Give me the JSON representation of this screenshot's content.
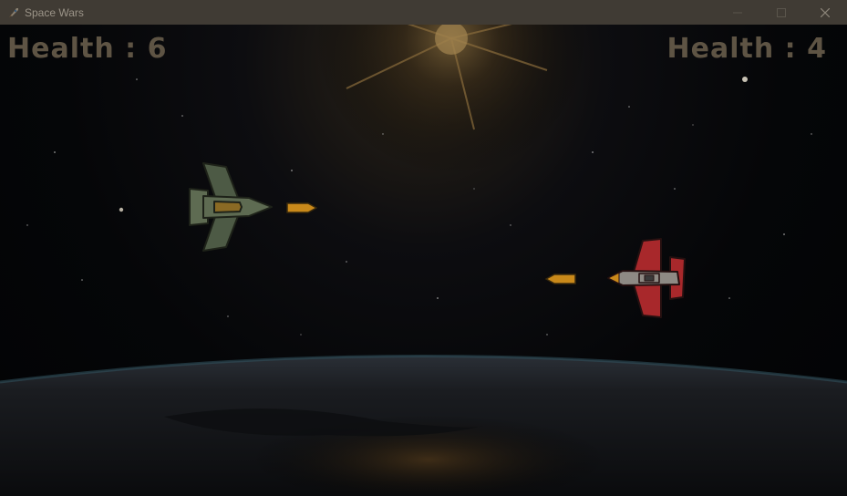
{
  "window": {
    "title": "Space Wars",
    "icon": "rocket-icon",
    "controls": [
      "minimize-icon",
      "maximize-icon",
      "close-icon"
    ]
  },
  "hud": {
    "player1_health": "Health : 6",
    "player2_health": "Health : 4"
  },
  "colors": {
    "titlebar": "#403b34",
    "hud_text": "#5e5444",
    "bullet": "#c9891a",
    "player1_ship": "#5e6b52",
    "player2_ship": "#a8282b"
  }
}
